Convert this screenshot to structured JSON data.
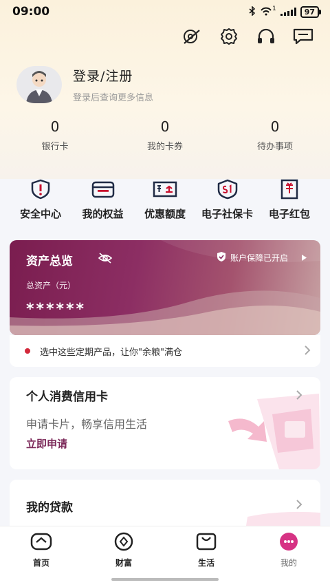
{
  "status_bar": {
    "time": "09:00",
    "network_label": "1",
    "battery": "97"
  },
  "header_icons": [
    "settings-edit-icon",
    "gear-icon",
    "headset-icon",
    "message-icon"
  ],
  "profile": {
    "title": "登录/注册",
    "subtitle": "登录后查询更多信息"
  },
  "stats": [
    {
      "value": "0",
      "label": "银行卡"
    },
    {
      "value": "0",
      "label": "我的卡券"
    },
    {
      "value": "0",
      "label": "待办事项"
    }
  ],
  "quick_actions": [
    {
      "label": "安全中心",
      "icon": "shield-alert-icon"
    },
    {
      "label": "我的权益",
      "icon": "card-wallet-icon"
    },
    {
      "label": "优惠额度",
      "icon": "coupon-icon"
    },
    {
      "label": "电子社保卡",
      "icon": "social-security-icon"
    },
    {
      "label": "电子红包",
      "icon": "red-packet-icon"
    }
  ],
  "asset": {
    "title": "资产总览",
    "guard_text": "账户保障已开启",
    "total_label": "总资产（元）",
    "total_value": "******"
  },
  "promo": {
    "text": "选中这些定期产品，让你\"余粮\"满仓"
  },
  "credit_card": {
    "title": "个人消费信用卡",
    "subtitle": "申请卡片，畅享信用生活",
    "cta": "立即申请"
  },
  "loan": {
    "title": "我的贷款"
  },
  "tabs": [
    {
      "label": "首页",
      "icon": "home-icon"
    },
    {
      "label": "财富",
      "icon": "wealth-icon"
    },
    {
      "label": "生活",
      "icon": "shopping-bag-icon"
    },
    {
      "label": "我的",
      "icon": "profile-icon",
      "active": true
    }
  ],
  "colors": {
    "brand": "#7c2a5a",
    "accent_red": "#d3293b"
  }
}
